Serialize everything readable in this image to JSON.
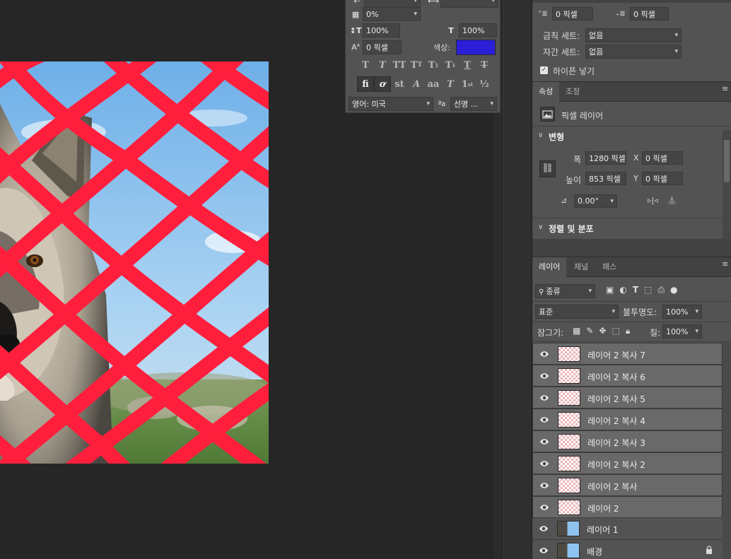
{
  "character_panel": {
    "tracking_value": "0%",
    "vertical_scale": "100%",
    "horizontal_scale": "100%",
    "baseline_shift": "0 픽셀",
    "color_label": "색상:",
    "color_swatch": "#2a1fd6",
    "language": "영어: 미국",
    "antialias_icon_label": "ªa",
    "antialias": "선명 ..."
  },
  "paragraph_extra": {
    "indent_before": "0 픽셀",
    "indent_after": "0 픽셀",
    "kinsoku_label": "금칙 세트:",
    "kinsoku_value": "없음",
    "mojikumi_label": "자간 세트:",
    "mojikumi_value": "없음",
    "hyphenate_label": "하이픈 넣기"
  },
  "properties": {
    "tabs": [
      "속성",
      "조정"
    ],
    "layer_type": "픽셀 레이어",
    "transform_title": "변형",
    "width_label": "폭",
    "width_value": "1280 픽셀",
    "height_label": "높이",
    "height_value": "853 픽셀",
    "x_label": "X",
    "x_value": "0 픽셀",
    "y_label": "Y",
    "y_value": "0 픽셀",
    "angle_value": "0.00°",
    "align_title": "정렬 및 분포"
  },
  "layers_panel": {
    "tabs": [
      "레이어",
      "채널",
      "패스"
    ],
    "filter_kind": "종류",
    "blend_mode": "표준",
    "opacity_label": "불투명도:",
    "opacity_value": "100%",
    "lock_label": "잠그기:",
    "fill_label": "칠:",
    "fill_value": "100%",
    "layers": [
      {
        "name": "레이어 2 복사 7",
        "thumb": "transparent",
        "selected": true
      },
      {
        "name": "레이어 2 복사 6",
        "thumb": "transparent",
        "selected": true
      },
      {
        "name": "레이어 2 복사 5",
        "thumb": "transparent",
        "selected": true
      },
      {
        "name": "레이어 2 복사 4",
        "thumb": "transparent",
        "selected": true
      },
      {
        "name": "레이어 2 복사 3",
        "thumb": "transparent",
        "selected": true
      },
      {
        "name": "레이어 2 복사 2",
        "thumb": "transparent",
        "selected": true
      },
      {
        "name": "레이어 2 복사",
        "thumb": "transparent",
        "selected": true
      },
      {
        "name": "레이어 2",
        "thumb": "transparent",
        "selected": true
      },
      {
        "name": "레이어 1",
        "thumb": "photo",
        "selected": false
      },
      {
        "name": "배경",
        "thumb": "photo",
        "selected": false,
        "locked": true
      }
    ]
  },
  "colors": {
    "net_red": "#ff1f3d",
    "sky": "#8fc3ef",
    "panel_bg": "#535353"
  }
}
